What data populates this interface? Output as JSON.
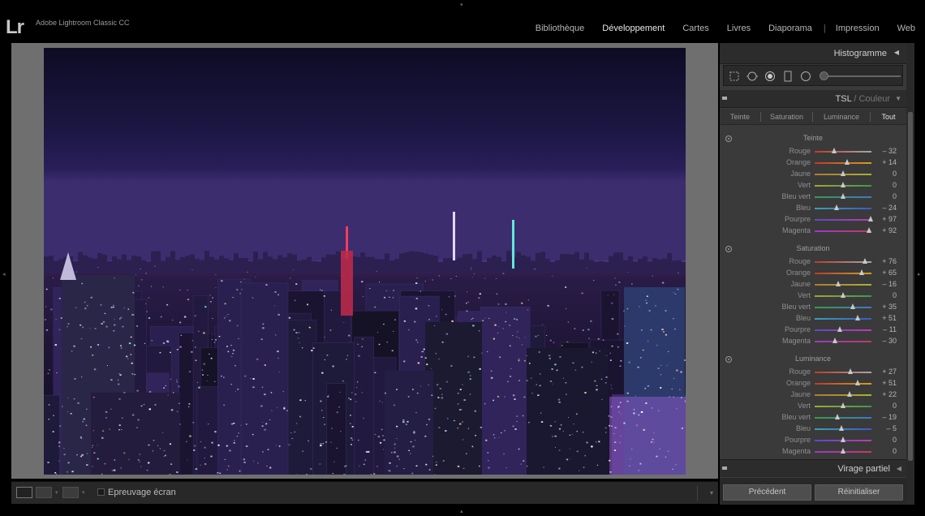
{
  "app": {
    "logo": "Lr",
    "title": "Adobe Lightroom Classic CC"
  },
  "modules": [
    {
      "label": "Bibliothèque",
      "active": false
    },
    {
      "label": "Développement",
      "active": true
    },
    {
      "label": "Cartes",
      "active": false
    },
    {
      "label": "Livres",
      "active": false
    },
    {
      "label": "Diaporama",
      "active": false
    },
    {
      "label": "Impression",
      "active": false
    },
    {
      "label": "Web",
      "active": false
    }
  ],
  "toolbar": {
    "proof_label": "Epreuvage écran",
    "proof_checked": false
  },
  "panel": {
    "histogram_title": "Histogramme",
    "tsl_title": "TSL",
    "tsl_title_alt": "Couleur",
    "tabs": [
      "Teinte",
      "Saturation",
      "Luminance",
      "Tout"
    ],
    "active_tab": "Tout",
    "slider_range": [
      -100,
      100
    ],
    "sections": [
      {
        "title": "Teinte",
        "rows": [
          {
            "label": "Rouge",
            "value": -32,
            "display": "– 32"
          },
          {
            "label": "Orange",
            "value": 14,
            "display": "+ 14"
          },
          {
            "label": "Jaune",
            "value": 0,
            "display": "0"
          },
          {
            "label": "Vert",
            "value": 0,
            "display": "0"
          },
          {
            "label": "Bleu vert",
            "value": 0,
            "display": "0"
          },
          {
            "label": "Bleu",
            "value": -24,
            "display": "– 24"
          },
          {
            "label": "Pourpre",
            "value": 97,
            "display": "+ 97"
          },
          {
            "label": "Magenta",
            "value": 92,
            "display": "+ 92"
          }
        ]
      },
      {
        "title": "Saturation",
        "rows": [
          {
            "label": "Rouge",
            "value": 76,
            "display": "+ 76"
          },
          {
            "label": "Orange",
            "value": 65,
            "display": "+ 65"
          },
          {
            "label": "Jaune",
            "value": -16,
            "display": "– 16"
          },
          {
            "label": "Vert",
            "value": 0,
            "display": "0"
          },
          {
            "label": "Bleu vert",
            "value": 35,
            "display": "+ 35"
          },
          {
            "label": "Bleu",
            "value": 51,
            "display": "+ 51"
          },
          {
            "label": "Pourpre",
            "value": -11,
            "display": "– 11"
          },
          {
            "label": "Magenta",
            "value": -30,
            "display": "– 30"
          }
        ]
      },
      {
        "title": "Luminance",
        "rows": [
          {
            "label": "Rouge",
            "value": 27,
            "display": "+ 27"
          },
          {
            "label": "Orange",
            "value": 51,
            "display": "+ 51"
          },
          {
            "label": "Jaune",
            "value": 22,
            "display": "+ 22"
          },
          {
            "label": "Vert",
            "value": 0,
            "display": "0"
          },
          {
            "label": "Bleu vert",
            "value": -19,
            "display": "– 19"
          },
          {
            "label": "Bleu",
            "value": -5,
            "display": "– 5"
          },
          {
            "label": "Pourpre",
            "value": 0,
            "display": "0"
          },
          {
            "label": "Magenta",
            "value": 0,
            "display": "0"
          }
        ]
      }
    ],
    "virage_title": "Virage partiel",
    "previous_button": "Précédent",
    "reset_button": "Réinitialiser"
  },
  "colors": {
    "track": {
      "Rouge": [
        "#c0392b",
        "#a6a6a6"
      ],
      "Orange": [
        "#c0392b",
        "#d4a017"
      ],
      "Jaune": [
        "#b07a2a",
        "#a8b232"
      ],
      "Vert": [
        "#a0a832",
        "#3a9a4a"
      ],
      "Bleu vert": [
        "#3a9a4a",
        "#3a7bc8"
      ],
      "Bleu": [
        "#3aa0b0",
        "#3a5bc8"
      ],
      "Pourpre": [
        "#5a4ac8",
        "#c03ab0"
      ],
      "Magenta": [
        "#9a3ac8",
        "#c03a6a"
      ]
    }
  }
}
